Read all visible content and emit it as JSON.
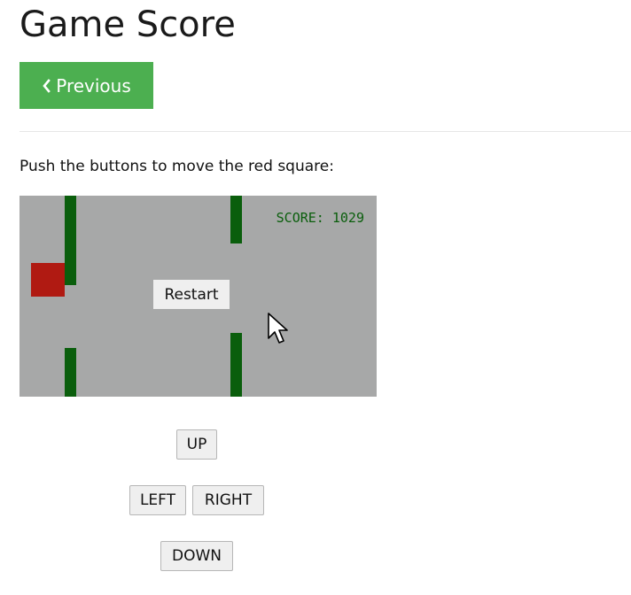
{
  "page": {
    "title": "Game Score",
    "previous_label": "Previous",
    "instructions": "Push the buttons to move the red square:"
  },
  "game": {
    "score_text": "SCORE: 1029",
    "restart_label": "Restart",
    "colors": {
      "background": "#a7a8a8",
      "obstacle": "#0a5e0c",
      "player": "#b01a12",
      "score": "#0a5e0c"
    }
  },
  "controls": {
    "up": "UP",
    "left": "LEFT",
    "right": "RIGHT",
    "down": "DOWN"
  },
  "theme": {
    "accent": "#4caf50"
  },
  "icons": {
    "previous": "chevron-left-icon",
    "pointer": "mouse-cursor-icon"
  }
}
